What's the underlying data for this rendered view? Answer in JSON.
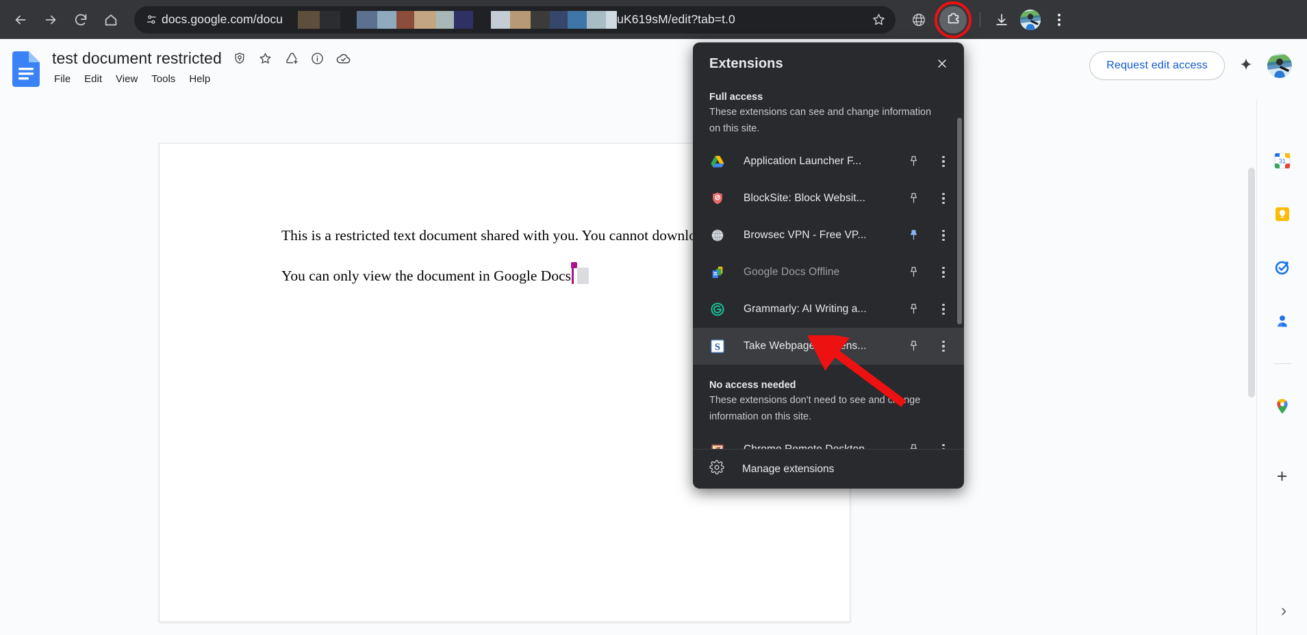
{
  "browser": {
    "nav": {
      "back": "back-arrow",
      "forward": "forward-arrow",
      "reload": "reload",
      "home": "home"
    },
    "omnibox": {
      "url_prefix": "docs.google.com/docu",
      "url_suffix": "uK619sM/edit?tab=t.0",
      "redactions_a": [
        "#5d4f3b",
        "#2b2d30"
      ],
      "redactions_b": [
        "#5b718f",
        "#8fa9bf",
        "#8c4d3c",
        "#c3a681",
        "#a9b7b8",
        "#2f3164"
      ],
      "redactions_c": [
        "#c3cdd3",
        "#b79a75",
        "#3b3b3a",
        "#37466b",
        "#3e76a7",
        "#a8bcc6",
        "#cfdbe1"
      ],
      "bookmark_icon": "star-icon",
      "permissions_icon": "tune-icon"
    },
    "toolbar": {
      "translate_label": "globe-icon",
      "extensions_label": "puzzle-icon",
      "download_label": "download-icon",
      "profile_label": "avatar",
      "menu_label": "three-dot-menu"
    }
  },
  "docs": {
    "title": "test document restricted",
    "menus": [
      "File",
      "Edit",
      "View",
      "Tools",
      "Help"
    ],
    "title_icons": [
      "shield-check-icon",
      "star-icon",
      "move-to-drive-icon",
      "info-icon",
      "cloud-saved-icon"
    ],
    "request_edit_label": "Request edit access",
    "gemini_label": "gemini-sparkle-icon",
    "outline_label": "document-outline-icon",
    "document": {
      "paragraphs": [
        "This is a restricted text document shared with you.",
        "You cannot download the document.",
        "You can only view the document in Google Docs"
      ],
      "cursor_color": "#a8158a",
      "selection_color": "#dadce0"
    },
    "right_rail": [
      {
        "name": "google-calendar-icon",
        "label": "Calendar"
      },
      {
        "name": "google-keep-icon",
        "label": "Keep"
      },
      {
        "name": "google-tasks-icon",
        "label": "Tasks"
      },
      {
        "name": "google-contacts-icon",
        "label": "Contacts"
      },
      {
        "name": "google-maps-icon",
        "label": "Maps"
      }
    ],
    "add_on_label": "+",
    "expand_label": "›"
  },
  "extensions_panel": {
    "title": "Extensions",
    "close_label": "×",
    "sections": [
      {
        "heading": "Full access",
        "description": "These extensions can see and change information on this site.",
        "items": [
          {
            "name": "Application Launcher F...",
            "icon": "google-drive-icon",
            "pinned": false,
            "disabled": false,
            "hovered": false
          },
          {
            "name": "BlockSite: Block Websit...",
            "icon": "blocksite-shield-icon",
            "pinned": false,
            "disabled": false,
            "hovered": false
          },
          {
            "name": "Browsec VPN - Free VP...",
            "icon": "browsec-globe-icon",
            "pinned": true,
            "disabled": false,
            "hovered": false
          },
          {
            "name": "Google Docs Offline",
            "icon": "google-docs-offline-icon",
            "pinned": false,
            "disabled": true,
            "hovered": false
          },
          {
            "name": "Grammarly: AI Writing a...",
            "icon": "grammarly-icon",
            "pinned": false,
            "disabled": false,
            "hovered": false
          },
          {
            "name": "Take Webpage Screens...",
            "icon": "screenshot-s-icon",
            "pinned": false,
            "disabled": false,
            "hovered": true
          }
        ]
      },
      {
        "heading": "No access needed",
        "description": "These extensions don't need to see and change information on this site.",
        "items": [
          {
            "name": "Chrome Remote Desktop",
            "icon": "chrome-remote-desktop-icon",
            "pinned": false,
            "disabled": false,
            "hovered": false
          }
        ]
      }
    ],
    "manage_label": "Manage extensions",
    "manage_icon": "gear-icon",
    "pin_active_color": "#8ab4f8",
    "pin_inactive_color": "#c8ccd0"
  },
  "annotations": {
    "arrow_color": "#ee1111",
    "highlight_ring_color": "#ee1111"
  }
}
